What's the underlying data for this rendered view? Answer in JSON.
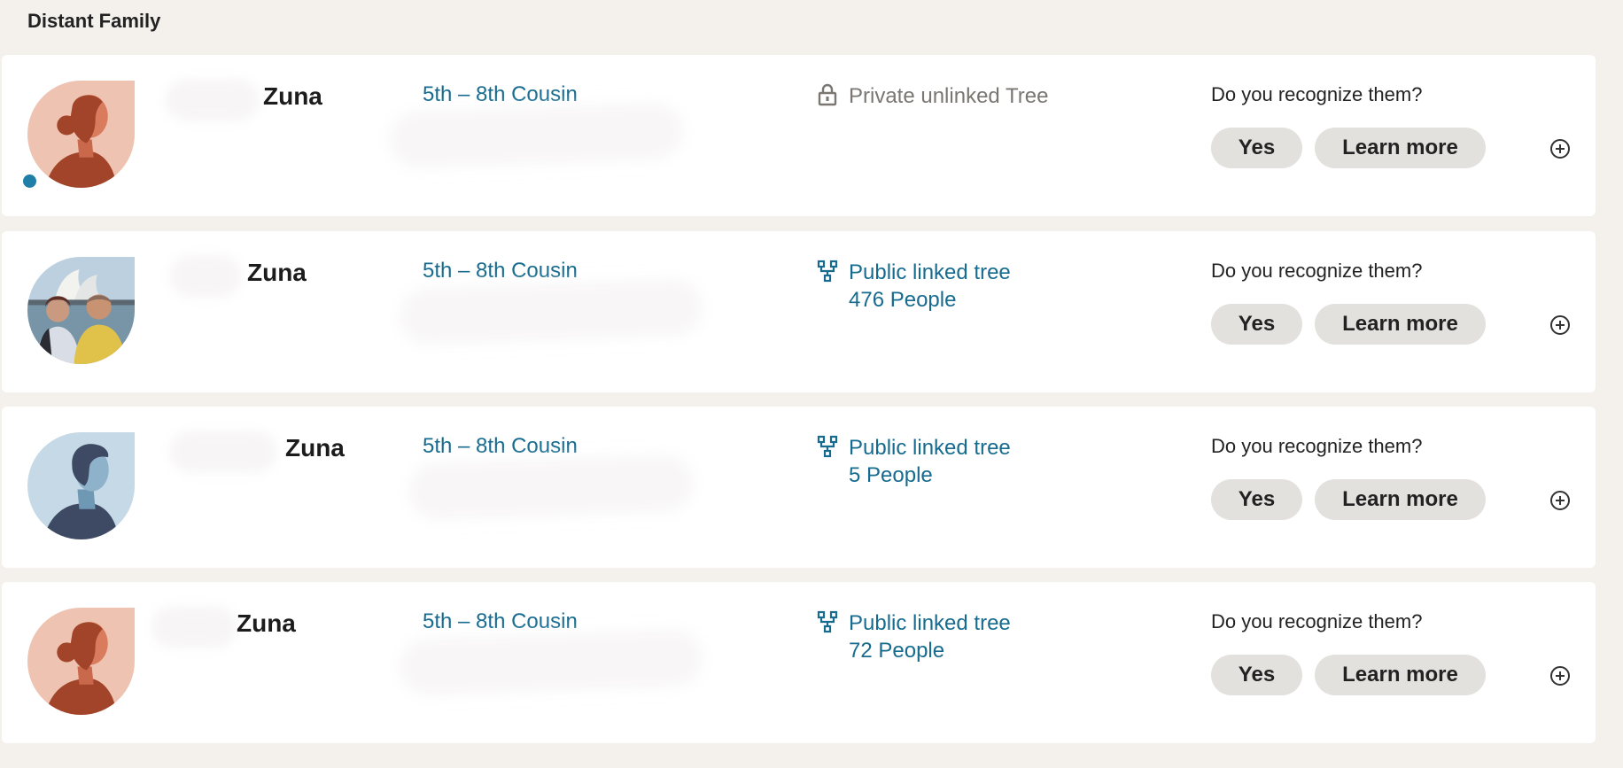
{
  "section": {
    "title": "Distant Family"
  },
  "colors": {
    "accent": "#166b8f",
    "new_dot": "#1f7fa8",
    "button_bg": "#e3e1de",
    "page_bg": "#f4f1ed"
  },
  "matches": [
    {
      "name": "Zuna",
      "avatar": "female-silhouette-avatar",
      "is_new": true,
      "relationship": "5th – 8th Cousin",
      "tree_icon": "lock-icon",
      "tree_label": "Private unlinked Tree",
      "tree_count": "",
      "question": "Do you recognize them?",
      "yes_label": "Yes",
      "learn_label": "Learn more",
      "expand_icon": "plus-circle-icon"
    },
    {
      "name": "Zuna",
      "avatar": "couple-photo-avatar",
      "is_new": false,
      "relationship": "5th – 8th Cousin",
      "tree_icon": "family-tree-icon",
      "tree_label": "Public linked tree",
      "tree_count": "476 People",
      "question": "Do you recognize them?",
      "yes_label": "Yes",
      "learn_label": "Learn more",
      "expand_icon": "plus-circle-icon"
    },
    {
      "name": "Zuna",
      "avatar": "male-silhouette-avatar",
      "is_new": false,
      "relationship": "5th – 8th Cousin",
      "tree_icon": "family-tree-icon",
      "tree_label": "Public linked tree",
      "tree_count": "5 People",
      "question": "Do you recognize them?",
      "yes_label": "Yes",
      "learn_label": "Learn more",
      "expand_icon": "plus-circle-icon"
    },
    {
      "name": "Zuna",
      "avatar": "female-silhouette-avatar",
      "is_new": false,
      "relationship": "5th – 8th Cousin",
      "tree_icon": "family-tree-icon",
      "tree_label": "Public linked tree",
      "tree_count": "72 People",
      "question": "Do you recognize them?",
      "yes_label": "Yes",
      "learn_label": "Learn more",
      "expand_icon": "plus-circle-icon"
    }
  ]
}
